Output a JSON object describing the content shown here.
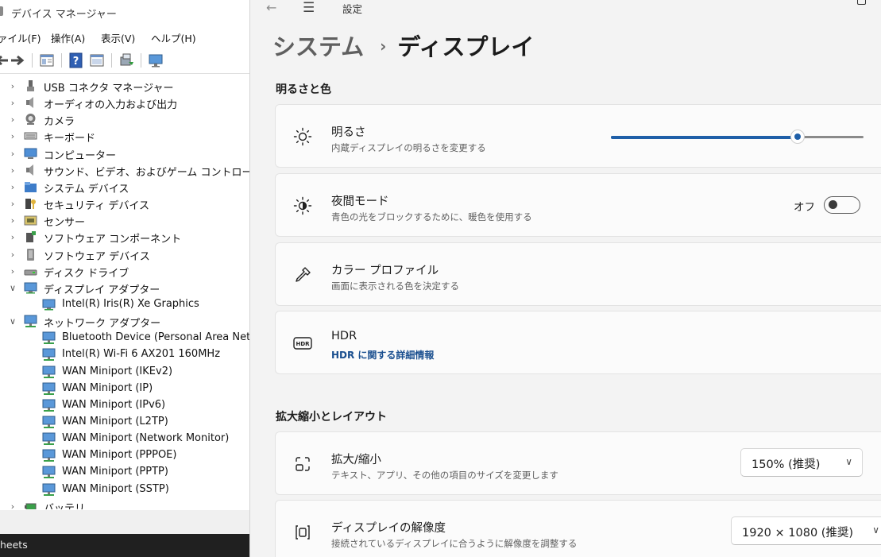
{
  "device_manager": {
    "title": "デバイス マネージャー",
    "menu": [
      "ァイル(F)",
      "操作(A)",
      "表示(V)",
      "ヘルプ(H)"
    ],
    "tree": [
      {
        "label": "USB コネクタ マネージャー",
        "expanded": false,
        "level": 0,
        "icon": "usb-icon"
      },
      {
        "label": "オーディオの入力および出力",
        "expanded": false,
        "level": 0,
        "icon": "speaker-icon"
      },
      {
        "label": "カメラ",
        "expanded": false,
        "level": 0,
        "icon": "camera-icon"
      },
      {
        "label": "キーボード",
        "expanded": false,
        "level": 0,
        "icon": "keyboard-icon"
      },
      {
        "label": "コンピューター",
        "expanded": false,
        "level": 0,
        "icon": "computer-icon"
      },
      {
        "label": "サウンド、ビデオ、およびゲーム コントローラー",
        "expanded": false,
        "level": 0,
        "icon": "speaker-icon"
      },
      {
        "label": "システム デバイス",
        "expanded": false,
        "level": 0,
        "icon": "folder-icon"
      },
      {
        "label": "セキュリティ デバイス",
        "expanded": false,
        "level": 0,
        "icon": "key-icon"
      },
      {
        "label": "センサー",
        "expanded": false,
        "level": 0,
        "icon": "sensor-icon"
      },
      {
        "label": "ソフトウェア コンポーネント",
        "expanded": false,
        "level": 0,
        "icon": "component-icon"
      },
      {
        "label": "ソフトウェア デバイス",
        "expanded": false,
        "level": 0,
        "icon": "device-icon"
      },
      {
        "label": "ディスク ドライブ",
        "expanded": false,
        "level": 0,
        "icon": "disk-icon"
      },
      {
        "label": "ディスプレイ アダプター",
        "expanded": true,
        "level": 0,
        "icon": "monitor-icon"
      },
      {
        "label": "Intel(R) Iris(R) Xe Graphics",
        "level": 1,
        "icon": "monitor-icon"
      },
      {
        "label": "ネットワーク アダプター",
        "expanded": true,
        "level": 0,
        "icon": "network-icon"
      },
      {
        "label": "Bluetooth Device (Personal Area Netwo",
        "level": 1,
        "icon": "network-icon"
      },
      {
        "label": "Intel(R) Wi-Fi 6 AX201 160MHz",
        "level": 1,
        "icon": "network-icon"
      },
      {
        "label": "WAN Miniport (IKEv2)",
        "level": 1,
        "icon": "network-icon"
      },
      {
        "label": "WAN Miniport (IP)",
        "level": 1,
        "icon": "network-icon"
      },
      {
        "label": "WAN Miniport (IPv6)",
        "level": 1,
        "icon": "network-icon"
      },
      {
        "label": "WAN Miniport (L2TP)",
        "level": 1,
        "icon": "network-icon"
      },
      {
        "label": "WAN Miniport (Network Monitor)",
        "level": 1,
        "icon": "network-icon"
      },
      {
        "label": "WAN Miniport (PPPOE)",
        "level": 1,
        "icon": "network-icon"
      },
      {
        "label": "WAN Miniport (PPTP)",
        "level": 1,
        "icon": "network-icon"
      },
      {
        "label": "WAN Miniport (SSTP)",
        "level": 1,
        "icon": "network-icon"
      },
      {
        "label": "バッテリ",
        "expanded": false,
        "level": 0,
        "icon": "battery-icon"
      }
    ],
    "taskbar_text": "heets"
  },
  "settings": {
    "app_title": "設定",
    "breadcrumb": {
      "parent": "システム",
      "separator": "›",
      "current": "ディスプレイ"
    },
    "section_brightness": "明るさと色",
    "brightness": {
      "title": "明るさ",
      "subtitle": "内蔵ディスプレイの明るさを変更する",
      "level": 0.74
    },
    "night_light": {
      "title": "夜間モード",
      "subtitle": "青色の光をブロックするために、暖色を使用する",
      "state_label": "オフ"
    },
    "color_profile": {
      "title": "カラー プロファイル",
      "subtitle": "画面に表示される色を決定する"
    },
    "hdr": {
      "title": "HDR",
      "link": "HDR に関する詳細情報",
      "icon_text": "HDR"
    },
    "section_layout": "拡大縮小とレイアウト",
    "scale": {
      "title": "拡大/縮小",
      "subtitle": "テキスト、アプリ、その他の項目のサイズを変更します",
      "value": "150% (推奨)"
    },
    "resolution": {
      "title": "ディスプレイの解像度",
      "subtitle": "接続されているディスプレイに合うように解像度を調整する",
      "value": "1920 × 1080 (推奨)"
    },
    "accent_color": "#1f5fa8"
  }
}
